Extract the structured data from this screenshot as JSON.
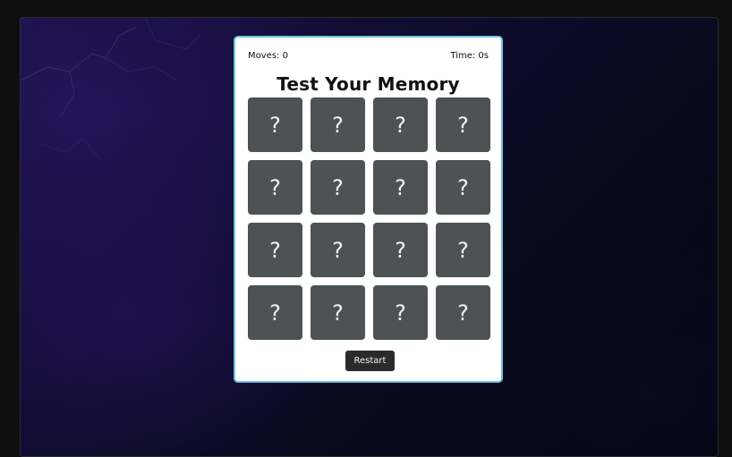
{
  "game": {
    "moves_text": "Moves: 0",
    "time_text": "Time: 0s",
    "title": "Test Your Memory",
    "restart_label": "Restart",
    "tiles": [
      "?",
      "?",
      "?",
      "?",
      "?",
      "?",
      "?",
      "?",
      "?",
      "?",
      "?",
      "?",
      "?",
      "?",
      "?",
      "?"
    ]
  },
  "colors": {
    "panel_border": "#6ec3dd",
    "tile_background": "#4d5354",
    "button_background": "#2a2a2a"
  }
}
